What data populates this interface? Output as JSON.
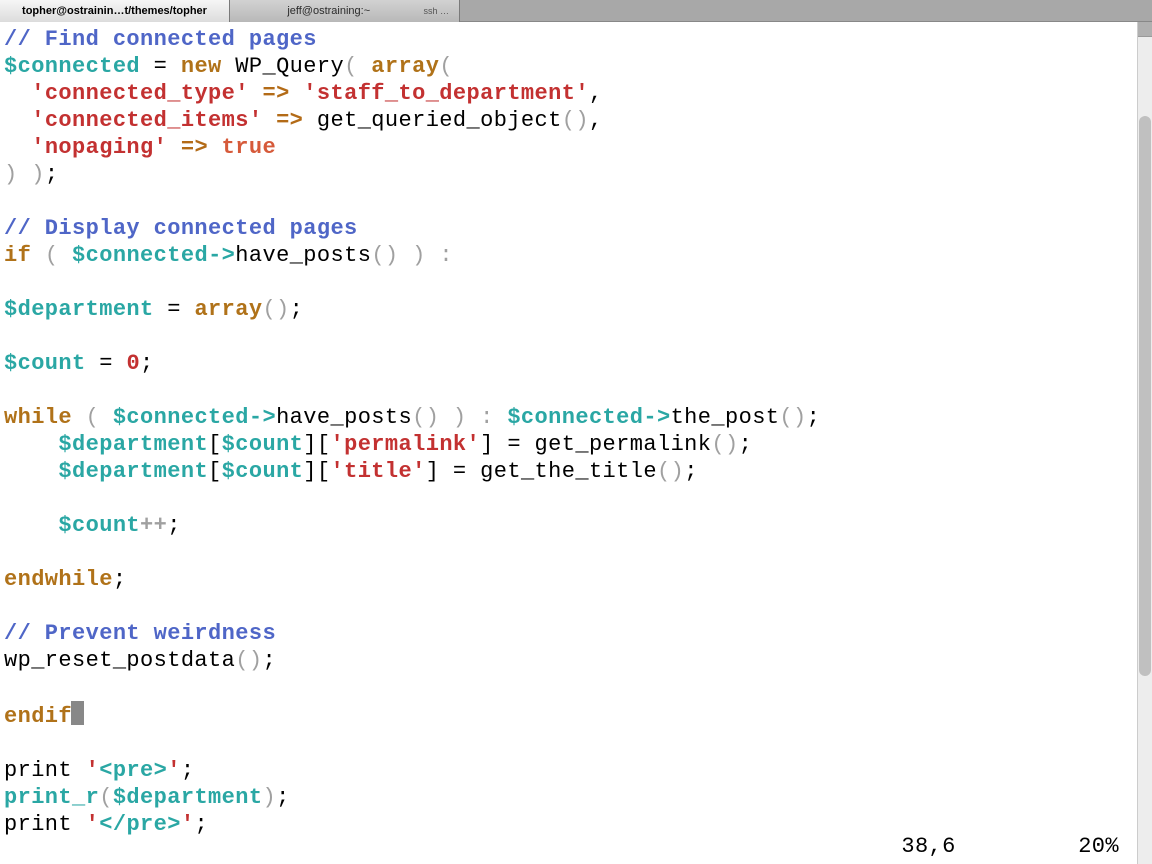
{
  "tabs": [
    {
      "label": "topher@ostrainin…t/themes/topher",
      "ssh": "",
      "active": true
    },
    {
      "label": "jeff@ostraining:~",
      "ssh": "ssh …",
      "active": false
    }
  ],
  "status": {
    "pos": "38,6",
    "pct": "20%"
  },
  "code": {
    "l1": "// Find connected pages",
    "l2a": "$connected",
    "l2b": " = ",
    "l2c": "new",
    "l2d": " WP_Query",
    "l2e": "( ",
    "l2f": "array",
    "l2g": "(",
    "l3a": "  ",
    "l3b": "'connected_type'",
    "l3c": " => ",
    "l3d": "'staff_to_department'",
    "l3e": ",",
    "l4a": "  ",
    "l4b": "'connected_items'",
    "l4c": " => ",
    "l4d": "get_queried_object",
    "l4e": "()",
    "l4f": ",",
    "l5a": "  ",
    "l5b": "'nopaging'",
    "l5c": " => ",
    "l5d": "true",
    "l6a": ") )",
    "l6b": ";",
    "l7": "// Display connected pages",
    "l8a": "if",
    "l8b": " ( ",
    "l8c": "$connected",
    "l8d": "->",
    "l8e": "have_posts",
    "l8f": "() ) :",
    "l9a": "$department",
    "l9b": " = ",
    "l9c": "array",
    "l9d": "()",
    "l9e": ";",
    "l10a": "$count",
    "l10b": " = ",
    "l10c": "0",
    "l10d": ";",
    "l11a": "while",
    "l11b": " ( ",
    "l11c": "$connected",
    "l11d": "->",
    "l11e": "have_posts",
    "l11f": "() ) : ",
    "l11g": "$connected",
    "l11h": "->",
    "l11i": "the_post",
    "l11j": "()",
    "l11k": ";",
    "l12a": "    ",
    "l12b": "$department",
    "l12c": "[",
    "l12d": "$count",
    "l12e": "][",
    "l12f": "'permalink'",
    "l12g": "] = ",
    "l12h": "get_permalink",
    "l12i": "()",
    "l12j": ";",
    "l13a": "    ",
    "l13b": "$department",
    "l13c": "[",
    "l13d": "$count",
    "l13e": "][",
    "l13f": "'title'",
    "l13g": "] = ",
    "l13h": "get_the_title",
    "l13i": "()",
    "l13j": ";",
    "l14a": "    ",
    "l14b": "$count",
    "l14c": "++",
    "l14d": ";",
    "l15a": "endwhile",
    "l15b": ";",
    "l16": "// Prevent weirdness",
    "l17a": "wp_reset_postdata",
    "l17b": "()",
    "l17c": ";",
    "l18a": "endif",
    "l19a": "print",
    "l19b": " ",
    "l19c": "'",
    "l19d": "<pre>",
    "l19e": "'",
    "l19f": ";",
    "l20a": "print_r",
    "l20b": "(",
    "l20c": "$department",
    "l20d": ")",
    "l20e": ";",
    "l21a": "print",
    "l21b": " ",
    "l21c": "'",
    "l21d": "</pre>",
    "l21e": "'",
    "l21f": ";"
  }
}
